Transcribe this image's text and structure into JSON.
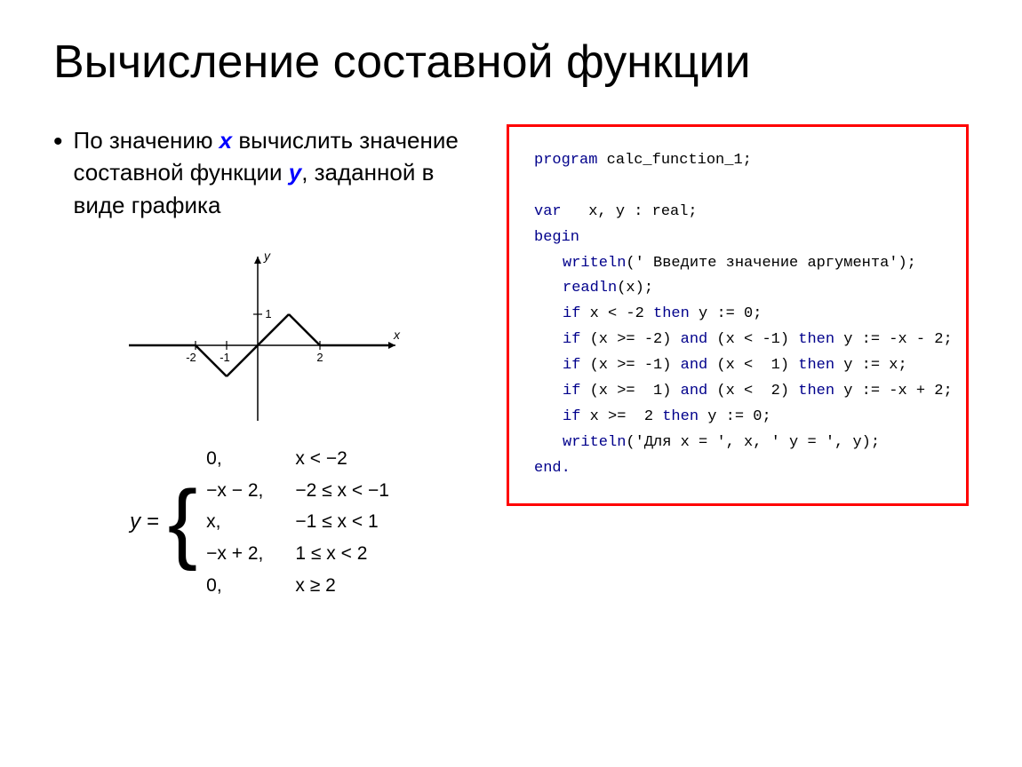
{
  "title": "Вычисление составной функции",
  "bullet": {
    "prefix": "По значению ",
    "x_var": "x",
    "middle": " вычислить значение составной функции ",
    "y_var": "y",
    "suffix": ", заданной в виде графика"
  },
  "formula": {
    "lhs": "y =",
    "rows": [
      {
        "expr": "0,",
        "cond": "x < −2"
      },
      {
        "expr": "−x − 2,",
        "cond": "−2 ≤ x < −1"
      },
      {
        "expr": "x,",
        "cond": "−1 ≤ x < 1"
      },
      {
        "expr": "−x + 2,",
        "cond": "1 ≤ x < 2"
      },
      {
        "expr": "0,",
        "cond": "x ≥ 2"
      }
    ]
  },
  "code": {
    "lines": [
      {
        "type": "normal",
        "text": "program calc_function_1;",
        "keyword_end": 7
      },
      {
        "type": "blank"
      },
      {
        "type": "normal",
        "text": "var   x, y : real;",
        "keyword_end": 3
      },
      {
        "type": "normal",
        "text": "begin",
        "keyword_end": 5
      },
      {
        "type": "indented",
        "text": "writeln(' Введите значение аргумента');"
      },
      {
        "type": "indented",
        "text": "readln(x);"
      },
      {
        "type": "indented",
        "text": "if x < -2 then y := 0;"
      },
      {
        "type": "indented",
        "text": "if (x >= -2) and (x < -1) then y := -x - 2;"
      },
      {
        "type": "indented",
        "text": "if (x >= -1) and (x <  1) then y := x;"
      },
      {
        "type": "indented",
        "text": "if (x >=  1) and (x <  2) then y := -x + 2;"
      },
      {
        "type": "indented",
        "text": "if x >=  2 then y := 0;"
      },
      {
        "type": "indented",
        "text": "writeln('Для x = ', x, ' y = ', y);"
      },
      {
        "type": "normal",
        "text": "end.",
        "keyword_end": 3
      }
    ]
  }
}
